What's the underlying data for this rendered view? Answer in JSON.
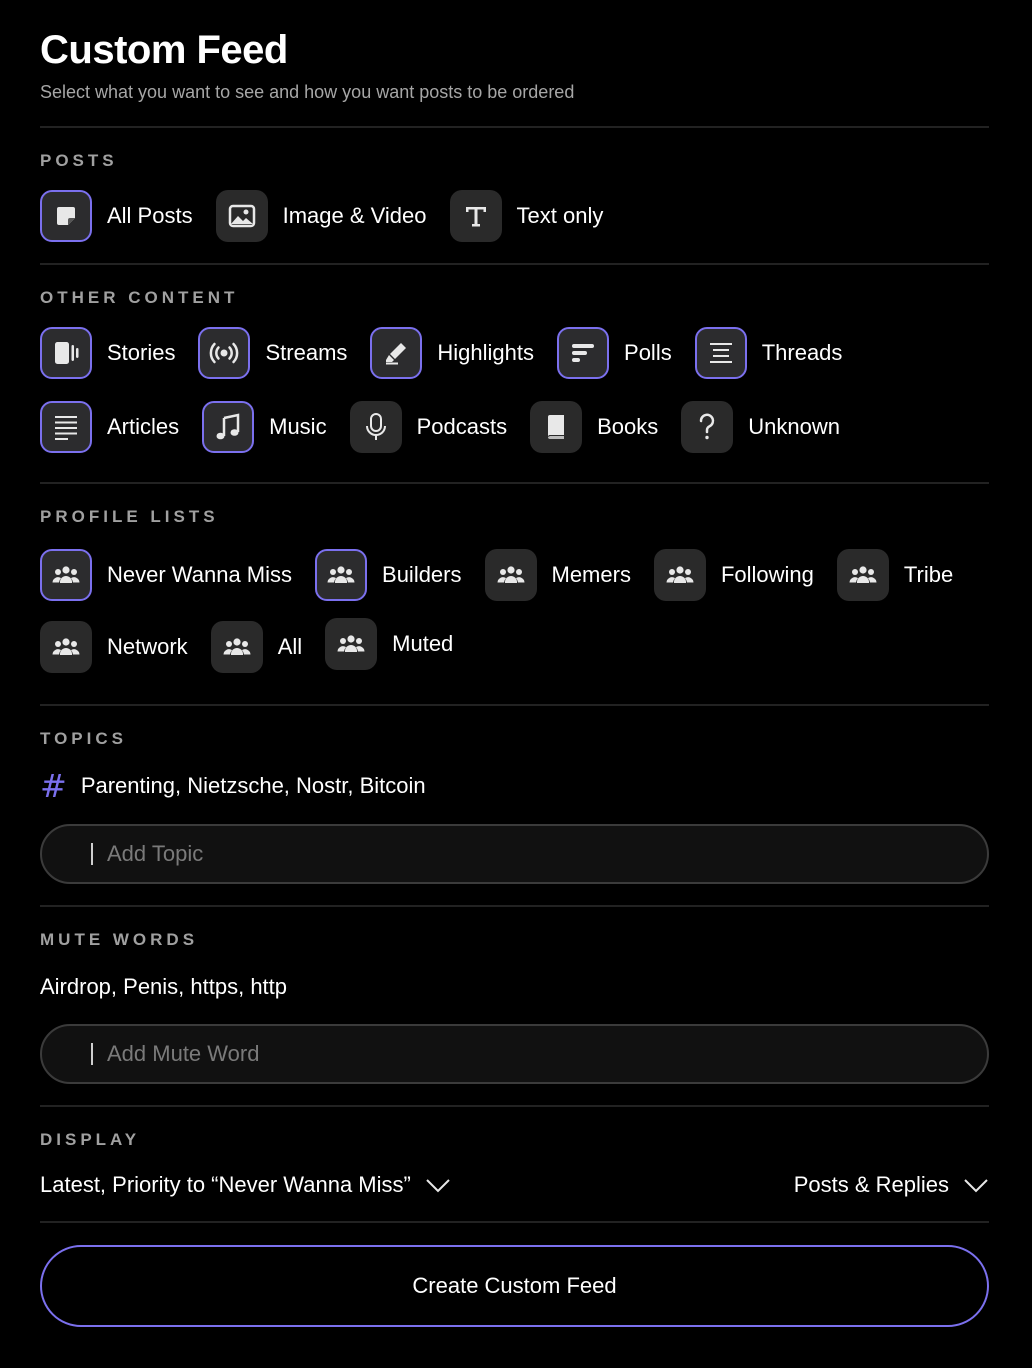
{
  "header": {
    "title": "Custom Feed",
    "subtitle": "Select what you want to see and how you want posts to be ordered"
  },
  "accent_color": "#7b70ee",
  "posts": {
    "label": "POSTS",
    "items": [
      {
        "label": "All Posts",
        "icon": "sticky-note-icon",
        "selected": true
      },
      {
        "label": "Image & Video",
        "icon": "image-icon",
        "selected": false
      },
      {
        "label": "Text only",
        "icon": "text-t-icon",
        "selected": false
      }
    ]
  },
  "other_content": {
    "label": "OTHER CONTENT",
    "items": [
      {
        "label": "Stories",
        "icon": "stories-icon",
        "selected": true
      },
      {
        "label": "Streams",
        "icon": "broadcast-icon",
        "selected": true
      },
      {
        "label": "Highlights",
        "icon": "highlighter-icon",
        "selected": true
      },
      {
        "label": "Polls",
        "icon": "poll-bars-icon",
        "selected": true
      },
      {
        "label": "Threads",
        "icon": "thread-lines-icon",
        "selected": true
      },
      {
        "label": "Articles",
        "icon": "article-lines-icon",
        "selected": true
      },
      {
        "label": "Music",
        "icon": "music-note-icon",
        "selected": true
      },
      {
        "label": "Podcasts",
        "icon": "microphone-icon",
        "selected": false
      },
      {
        "label": "Books",
        "icon": "book-icon",
        "selected": false
      },
      {
        "label": "Unknown",
        "icon": "question-mark-icon",
        "selected": false
      }
    ]
  },
  "profile_lists": {
    "label": "PROFILE LISTS",
    "items": [
      {
        "label": "Never Wanna Miss",
        "icon": "group-icon",
        "selected": true
      },
      {
        "label": "Builders",
        "icon": "group-icon",
        "selected": true
      },
      {
        "label": "Memers",
        "icon": "group-icon",
        "selected": false
      },
      {
        "label": "Following",
        "icon": "group-icon",
        "selected": false
      },
      {
        "label": "Tribe",
        "icon": "group-icon",
        "selected": false
      },
      {
        "label": "Network",
        "icon": "group-icon",
        "selected": false
      },
      {
        "label": "All",
        "icon": "group-icon",
        "selected": false
      },
      {
        "label": "Muted",
        "icon": "group-icon",
        "selected": false
      }
    ]
  },
  "topics": {
    "label": "TOPICS",
    "hash": "#",
    "value": "Parenting, Nietzsche, Nostr, Bitcoin",
    "placeholder": "Add Topic"
  },
  "mute_words": {
    "label": "MUTE WORDS",
    "value": "Airdrop, Penis, https, http",
    "placeholder": "Add Mute Word"
  },
  "display": {
    "label": "DISPLAY",
    "sort_value": "Latest, Priority to “Never Wanna Miss”",
    "type_value": "Posts & Replies"
  },
  "create_button": "Create Custom Feed"
}
